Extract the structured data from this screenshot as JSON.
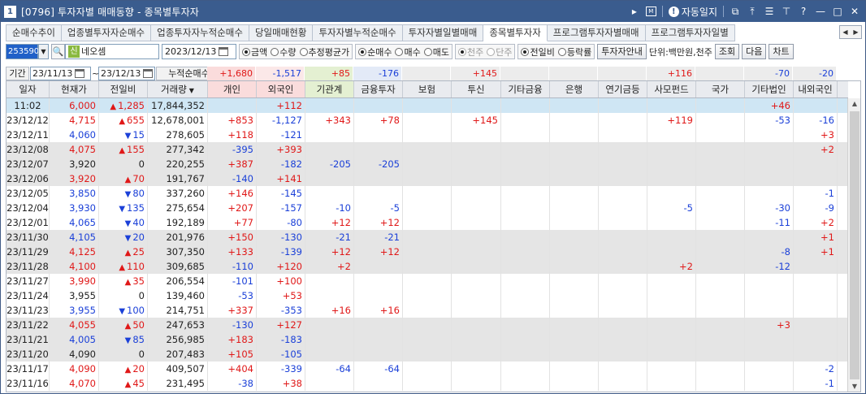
{
  "window": {
    "number": "1",
    "title": "[0796] 투자자별 매매동향 - 종목별투자자",
    "auto_log_label": "자동일지",
    "auto_log_icon": "info-icon",
    "help_label": "?"
  },
  "tabs": [
    {
      "label": "순매수추이",
      "active": false
    },
    {
      "label": "업종별투자자순매수",
      "active": false
    },
    {
      "label": "업종투자자누적순매수",
      "active": false
    },
    {
      "label": "당일매매현황",
      "active": false
    },
    {
      "label": "투자자별누적순매수",
      "active": false
    },
    {
      "label": "투자자별일별매매",
      "active": false
    },
    {
      "label": "종목별투자자",
      "active": true
    },
    {
      "label": "프로그램투자자별매매",
      "active": false
    },
    {
      "label": "프로그램투자자일별",
      "active": false
    }
  ],
  "toolbar": {
    "stock_code": "253590",
    "shin_badge": "신",
    "stock_name": "네오셈",
    "date": "2023/12/13",
    "value_type": {
      "options": [
        "금액",
        "수량",
        "추정평균가"
      ],
      "selected": 0
    },
    "trade_type": {
      "options": [
        "순매수",
        "매수",
        "매도"
      ],
      "selected": 0
    },
    "unit_type": {
      "options": [
        "천주",
        "단주"
      ],
      "selected": 0
    },
    "compare_type": {
      "options": [
        "전일비",
        "등락률"
      ],
      "selected": 0
    },
    "investor_guide_button": "투자자안내",
    "unit_label": "단위:백만원,천주",
    "query_button": "조회",
    "next_button": "다음",
    "chart_button": "차트"
  },
  "period": {
    "label": "기간",
    "from": "23/11/13",
    "tilde": "~",
    "to": "23/12/13",
    "cumulative_label": "누적순매수",
    "sums": {
      "individual": "+1,680",
      "foreign": "-1,517",
      "institution": "+85",
      "financial": "-176",
      "insurance": "",
      "trust": "+145",
      "other_fin": "",
      "bank": "",
      "pension": "",
      "private_fund": "+116",
      "nation": "",
      "other_corp": "-70",
      "domestic_foreign": "-20"
    }
  },
  "columns": [
    "일자",
    "현재가",
    "전일비",
    "거래량",
    "개인",
    "외국인",
    "기관계",
    "금융투자",
    "보험",
    "투신",
    "기타금융",
    "은행",
    "연기금등",
    "사모펀드",
    "국가",
    "기타법인",
    "내외국인"
  ],
  "rows": [
    {
      "date": "11:02",
      "price": "6,000",
      "dir": "up",
      "change": "1,285",
      "volume": "17,844,352",
      "individual": "",
      "foreign": "+112",
      "institution": "",
      "financial": "",
      "insurance": "",
      "trust": "",
      "other_fin": "",
      "bank": "",
      "pension": "",
      "private_fund": "",
      "nation": "",
      "other_corp": "+46",
      "domestic_foreign": ""
    },
    {
      "date": "23/12/12",
      "price": "4,715",
      "dir": "up",
      "change": "655",
      "volume": "12,678,001",
      "individual": "+853",
      "foreign": "-1,127",
      "institution": "+343",
      "financial": "+78",
      "insurance": "",
      "trust": "+145",
      "other_fin": "",
      "bank": "",
      "pension": "",
      "private_fund": "+119",
      "nation": "",
      "other_corp": "-53",
      "domestic_foreign": "-16"
    },
    {
      "date": "23/12/11",
      "price": "4,060",
      "dir": "down",
      "change": "15",
      "volume": "278,605",
      "individual": "+118",
      "foreign": "-121",
      "institution": "",
      "financial": "",
      "insurance": "",
      "trust": "",
      "other_fin": "",
      "bank": "",
      "pension": "",
      "private_fund": "",
      "nation": "",
      "other_corp": "",
      "domestic_foreign": "+3"
    },
    {
      "date": "23/12/08",
      "price": "4,075",
      "dir": "up",
      "change": "155",
      "volume": "277,342",
      "individual": "-395",
      "foreign": "+393",
      "institution": "",
      "financial": "",
      "insurance": "",
      "trust": "",
      "other_fin": "",
      "bank": "",
      "pension": "",
      "private_fund": "",
      "nation": "",
      "other_corp": "",
      "domestic_foreign": "+2"
    },
    {
      "date": "23/12/07",
      "price": "3,920",
      "dir": "flat",
      "change": "0",
      "volume": "220,255",
      "individual": "+387",
      "foreign": "-182",
      "institution": "-205",
      "financial": "-205",
      "insurance": "",
      "trust": "",
      "other_fin": "",
      "bank": "",
      "pension": "",
      "private_fund": "",
      "nation": "",
      "other_corp": "",
      "domestic_foreign": ""
    },
    {
      "date": "23/12/06",
      "price": "3,920",
      "dir": "up",
      "change": "70",
      "volume": "191,767",
      "individual": "-140",
      "foreign": "+141",
      "institution": "",
      "financial": "",
      "insurance": "",
      "trust": "",
      "other_fin": "",
      "bank": "",
      "pension": "",
      "private_fund": "",
      "nation": "",
      "other_corp": "",
      "domestic_foreign": ""
    },
    {
      "date": "23/12/05",
      "price": "3,850",
      "dir": "down",
      "change": "80",
      "volume": "337,260",
      "individual": "+146",
      "foreign": "-145",
      "institution": "",
      "financial": "",
      "insurance": "",
      "trust": "",
      "other_fin": "",
      "bank": "",
      "pension": "",
      "private_fund": "",
      "nation": "",
      "other_corp": "",
      "domestic_foreign": "-1"
    },
    {
      "date": "23/12/04",
      "price": "3,930",
      "dir": "down",
      "change": "135",
      "volume": "275,654",
      "individual": "+207",
      "foreign": "-157",
      "institution": "-10",
      "financial": "-5",
      "insurance": "",
      "trust": "",
      "other_fin": "",
      "bank": "",
      "pension": "",
      "private_fund": "-5",
      "nation": "",
      "other_corp": "-30",
      "domestic_foreign": "-9"
    },
    {
      "date": "23/12/01",
      "price": "4,065",
      "dir": "down",
      "change": "40",
      "volume": "192,189",
      "individual": "+77",
      "foreign": "-80",
      "institution": "+12",
      "financial": "+12",
      "insurance": "",
      "trust": "",
      "other_fin": "",
      "bank": "",
      "pension": "",
      "private_fund": "",
      "nation": "",
      "other_corp": "-11",
      "domestic_foreign": "+2"
    },
    {
      "date": "23/11/30",
      "price": "4,105",
      "dir": "down",
      "change": "20",
      "volume": "201,976",
      "individual": "+150",
      "foreign": "-130",
      "institution": "-21",
      "financial": "-21",
      "insurance": "",
      "trust": "",
      "other_fin": "",
      "bank": "",
      "pension": "",
      "private_fund": "",
      "nation": "",
      "other_corp": "",
      "domestic_foreign": "+1"
    },
    {
      "date": "23/11/29",
      "price": "4,125",
      "dir": "up",
      "change": "25",
      "volume": "307,350",
      "individual": "+133",
      "foreign": "-139",
      "institution": "+12",
      "financial": "+12",
      "insurance": "",
      "trust": "",
      "other_fin": "",
      "bank": "",
      "pension": "",
      "private_fund": "",
      "nation": "",
      "other_corp": "-8",
      "domestic_foreign": "+1"
    },
    {
      "date": "23/11/28",
      "price": "4,100",
      "dir": "up",
      "change": "110",
      "volume": "309,685",
      "individual": "-110",
      "foreign": "+120",
      "institution": "+2",
      "financial": "",
      "insurance": "",
      "trust": "",
      "other_fin": "",
      "bank": "",
      "pension": "",
      "private_fund": "+2",
      "nation": "",
      "other_corp": "-12",
      "domestic_foreign": ""
    },
    {
      "date": "23/11/27",
      "price": "3,990",
      "dir": "up",
      "change": "35",
      "volume": "206,554",
      "individual": "-101",
      "foreign": "+100",
      "institution": "",
      "financial": "",
      "insurance": "",
      "trust": "",
      "other_fin": "",
      "bank": "",
      "pension": "",
      "private_fund": "",
      "nation": "",
      "other_corp": "",
      "domestic_foreign": ""
    },
    {
      "date": "23/11/24",
      "price": "3,955",
      "dir": "flat",
      "change": "0",
      "volume": "139,460",
      "individual": "-53",
      "foreign": "+53",
      "institution": "",
      "financial": "",
      "insurance": "",
      "trust": "",
      "other_fin": "",
      "bank": "",
      "pension": "",
      "private_fund": "",
      "nation": "",
      "other_corp": "",
      "domestic_foreign": ""
    },
    {
      "date": "23/11/23",
      "price": "3,955",
      "dir": "down",
      "change": "100",
      "volume": "214,751",
      "individual": "+337",
      "foreign": "-353",
      "institution": "+16",
      "financial": "+16",
      "insurance": "",
      "trust": "",
      "other_fin": "",
      "bank": "",
      "pension": "",
      "private_fund": "",
      "nation": "",
      "other_corp": "",
      "domestic_foreign": ""
    },
    {
      "date": "23/11/22",
      "price": "4,055",
      "dir": "up",
      "change": "50",
      "volume": "247,653",
      "individual": "-130",
      "foreign": "+127",
      "institution": "",
      "financial": "",
      "insurance": "",
      "trust": "",
      "other_fin": "",
      "bank": "",
      "pension": "",
      "private_fund": "",
      "nation": "",
      "other_corp": "+3",
      "domestic_foreign": ""
    },
    {
      "date": "23/11/21",
      "price": "4,005",
      "dir": "down",
      "change": "85",
      "volume": "256,985",
      "individual": "+183",
      "foreign": "-183",
      "institution": "",
      "financial": "",
      "insurance": "",
      "trust": "",
      "other_fin": "",
      "bank": "",
      "pension": "",
      "private_fund": "",
      "nation": "",
      "other_corp": "",
      "domestic_foreign": ""
    },
    {
      "date": "23/11/20",
      "price": "4,090",
      "dir": "flat",
      "change": "0",
      "volume": "207,483",
      "individual": "+105",
      "foreign": "-105",
      "institution": "",
      "financial": "",
      "insurance": "",
      "trust": "",
      "other_fin": "",
      "bank": "",
      "pension": "",
      "private_fund": "",
      "nation": "",
      "other_corp": "",
      "domestic_foreign": ""
    },
    {
      "date": "23/11/17",
      "price": "4,090",
      "dir": "up",
      "change": "20",
      "volume": "409,507",
      "individual": "+404",
      "foreign": "-339",
      "institution": "-64",
      "financial": "-64",
      "insurance": "",
      "trust": "",
      "other_fin": "",
      "bank": "",
      "pension": "",
      "private_fund": "",
      "nation": "",
      "other_corp": "",
      "domestic_foreign": "-2"
    },
    {
      "date": "23/11/16",
      "price": "4,070",
      "dir": "up",
      "change": "45",
      "volume": "231,495",
      "individual": "-38",
      "foreign": "+38",
      "institution": "",
      "financial": "",
      "insurance": "",
      "trust": "",
      "other_fin": "",
      "bank": "",
      "pension": "",
      "private_fund": "",
      "nation": "",
      "other_corp": "",
      "domestic_foreign": "-1"
    }
  ],
  "colors": {
    "up": "#e01818",
    "down": "#1b40d8",
    "accent": "#3a5c8e"
  }
}
